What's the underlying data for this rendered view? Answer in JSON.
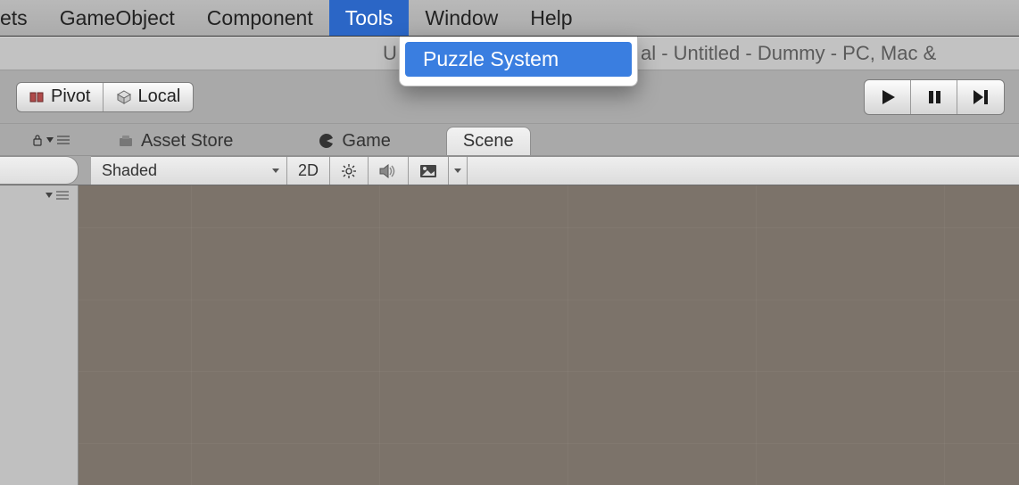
{
  "menubar": {
    "items": [
      {
        "label": "ets"
      },
      {
        "label": "GameObject"
      },
      {
        "label": "Component"
      },
      {
        "label": "Tools",
        "active": true
      },
      {
        "label": "Window"
      },
      {
        "label": "Help"
      }
    ]
  },
  "dropdown": {
    "items": [
      {
        "label": "Puzzle System"
      }
    ]
  },
  "titlebar": {
    "text": "al - Untitled - Dummy - PC, Mac &",
    "left_fragment": "U"
  },
  "toolbar": {
    "pivot_label": "Pivot",
    "local_label": "Local"
  },
  "tabs": {
    "asset_store": "Asset Store",
    "game": "Game",
    "scene": "Scene"
  },
  "scene_toolbar": {
    "shading_mode": "Shaded",
    "btn_2d": "2D"
  },
  "left_mini": {
    "arrow": "▾",
    "lock": "lock-icon"
  }
}
